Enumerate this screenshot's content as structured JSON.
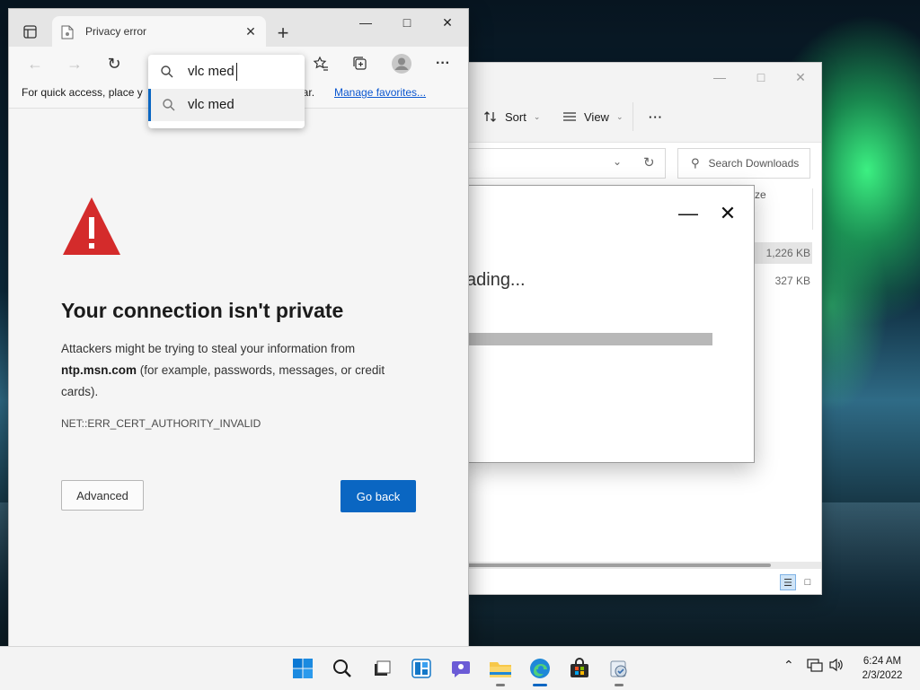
{
  "explorer": {
    "toolbar": {
      "sort_label": "Sort",
      "view_label": "View",
      "more_label": "···"
    },
    "search_placeholder": "Search Downloads",
    "column_header_partial": "ze",
    "rows": [
      {
        "size": "1,226 KB",
        "selected": true
      },
      {
        "size": "327 KB",
        "selected": false
      }
    ]
  },
  "progress_dialog": {
    "text_partial": "ading...",
    "progress_pct": 100
  },
  "browser": {
    "tab_title": "Privacy error",
    "favbar": {
      "message_start": "For quick access, place y",
      "message_end": "es bar.",
      "link": "Manage favorites..."
    },
    "omnibox": {
      "query": "vlc med",
      "suggestion": "vlc med"
    },
    "page": {
      "heading": "Your connection isn't private",
      "body_prefix": "Attackers might be trying to steal your information from",
      "domain": "ntp.msn.com",
      "body_suffix": "(for example, passwords, messages, or credit cards).",
      "error_code": "NET::ERR_CERT_AUTHORITY_INVALID",
      "advanced_button": "Advanced",
      "go_back_button": "Go back"
    }
  },
  "taskbar": {
    "apps": [
      "start",
      "search",
      "task-view",
      "widgets",
      "chat",
      "file-explorer",
      "edge",
      "store",
      "app"
    ],
    "clock": {
      "time": "6:24 AM",
      "date": "2/3/2022"
    }
  },
  "colors": {
    "accent": "#0a66c2",
    "warning": "#d42b2b"
  }
}
